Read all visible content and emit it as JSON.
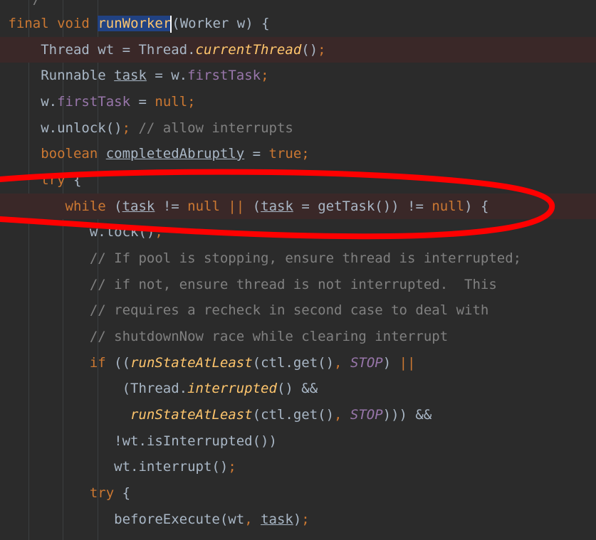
{
  "code": {
    "l0": {
      "comment": "*/"
    },
    "l1": {
      "kw_final": "final",
      "kw_void": "void",
      "method": "runWorker",
      "params": "(Worker w) {"
    },
    "l2": {
      "t1": "Thread wt = Thread.",
      "call": "currentThread",
      "t2": "()",
      "semi": ";"
    },
    "l3": {
      "t1": "Runnable ",
      "var": "task",
      "t2": " = w.",
      "field": "firstTask",
      "semi": ";"
    },
    "l4": {
      "t1": "w.",
      "field": "firstTask",
      "t2": " = ",
      "kw": "null",
      "semi": ";"
    },
    "l5": {
      "t1": "w.unlock()",
      "semi": ";",
      "comment": " // allow interrupts"
    },
    "l6": {
      "kw": "boolean",
      "t1": " ",
      "var": "completedAbruptly",
      "t2": " = ",
      "kw2": "true",
      "semi": ";"
    },
    "l7": {
      "kw": "try",
      "t1": " {"
    },
    "l8": {
      "kw": "while",
      "t1": " (",
      "var1": "task",
      "t2": " != ",
      "kw_null": "null",
      "op": " || ",
      "t3": "(",
      "var2": "task",
      "t4": " = getTask()) != ",
      "kw_null2": "null",
      "t5": ") {"
    },
    "l9": {
      "t1": "w.lock()",
      "semi": ";"
    },
    "l10": {
      "comment": "// If pool is stopping, ensure thread is interrupted;"
    },
    "l11": {
      "comment": "// if not, ensure thread is not interrupted.  This"
    },
    "l12": {
      "comment": "// requires a recheck in second case to deal with"
    },
    "l13": {
      "comment": "// shutdownNow race while clearing interrupt"
    },
    "l14": {
      "kw": "if",
      "t1": " ((",
      "call": "runStateAtLeast",
      "t2": "(ctl.get()",
      "comma": ", ",
      "const": "STOP",
      "t3": ") ",
      "op": "||"
    },
    "l15": {
      "t1": "(Thread.",
      "call": "interrupted",
      "t2": "() &&"
    },
    "l16": {
      "call": "runStateAtLeast",
      "t1": "(ctl.get()",
      "comma": ", ",
      "const": "STOP",
      "t2": "))) &&"
    },
    "l17": {
      "t1": "!wt.isInterrupted())"
    },
    "l18": {
      "t1": "wt.interrupt()",
      "semi": ";"
    },
    "l19": {
      "kw": "try",
      "t1": " {"
    },
    "l20": {
      "t1": "beforeExecute(wt",
      "comma": ", ",
      "var": "task",
      "t2": ")",
      "semi": ";"
    }
  },
  "colors": {
    "background": "#2b2b2b",
    "keyword": "#cc7832",
    "method": "#ffc66d",
    "field": "#9876aa",
    "comment": "#808080",
    "text": "#a9b7c6",
    "annotation": "#ff0000"
  }
}
